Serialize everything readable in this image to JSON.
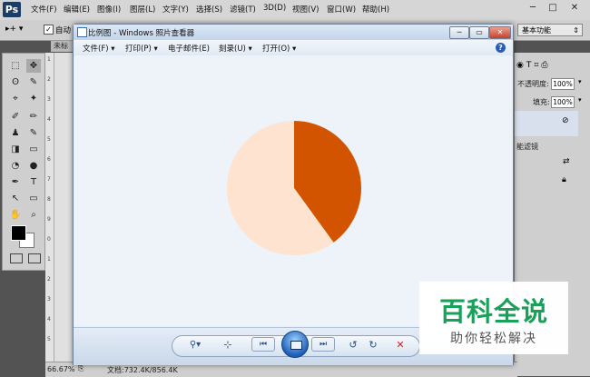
{
  "photoshop": {
    "logo": "Ps",
    "menus": [
      "文件(F)",
      "编辑(E)",
      "图像(I)",
      "图层(L)",
      "文字(Y)",
      "选择(S)",
      "滤镜(T)",
      "3D(D)",
      "视图(V)",
      "窗口(W)",
      "帮助(H)"
    ],
    "window_controls": [
      "─",
      "□",
      "✕"
    ],
    "options_bar": {
      "auto_select_label": "自动",
      "workspace": "基本功能"
    },
    "doc_tab": "未标",
    "tools": [
      "⬚",
      "✥",
      "ʘ",
      "✎",
      "⌖",
      "✦",
      "✐",
      "✏",
      "♟",
      "✎",
      "◨",
      "▭",
      "◔",
      "●",
      "✒",
      "T",
      "↖",
      "▭",
      "✋",
      "⌕"
    ],
    "ruler_marks": [
      "1",
      "2",
      "3",
      "4",
      "5",
      "6",
      "7",
      "8",
      "9",
      "0",
      "1",
      "2",
      "3",
      "4",
      "5"
    ],
    "right_panel": {
      "opacity_label": "不透明度:",
      "opacity_value": "100%",
      "fill_label": "填充:",
      "fill_value": "100%",
      "smart_filter_text": "能滤镜"
    },
    "status": {
      "zoom": "66.67%",
      "doc_info": "文档:732.4K/856.4K"
    }
  },
  "viewer": {
    "title": "比例图 - Windows 照片查看器",
    "menus": [
      "文件(F) ▾",
      "打印(P) ▾",
      "电子邮件(E)",
      "刻录(U) ▾",
      "打开(O) ▾"
    ],
    "help": "?",
    "window_buttons": [
      "─",
      "▭",
      "✕"
    ],
    "controls": {
      "zoom": "⚲▾",
      "fit": "⊹",
      "prev": "⏮",
      "next": "⏭",
      "rotate_ccw": "↺",
      "rotate_cw": "↻",
      "delete": "✕"
    }
  },
  "watermark": {
    "title": "百科全说",
    "subtitle": "助你轻松解决"
  },
  "chart_data": {
    "type": "pie",
    "title": "",
    "slices": [
      {
        "value": 40,
        "color": "#d35400"
      },
      {
        "value": 60,
        "color": "#fde3d0"
      }
    ]
  }
}
